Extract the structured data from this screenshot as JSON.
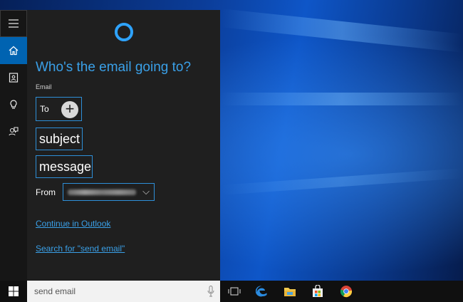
{
  "panel": {
    "heading": "Who's the email going to?",
    "field_label": "Email",
    "to_label": "To",
    "add_symbol": "+",
    "subject_placeholder": "subject",
    "message_placeholder": "message",
    "from_label": "From",
    "from_chevron": "⌵",
    "continue_link": "Continue in Outlook",
    "search_link": "Search for \"send email\""
  },
  "taskbar": {
    "search_value": "send email"
  },
  "colors": {
    "accent": "#3aa0e8",
    "rail_active": "#0063b1",
    "panel_bg": "#1f1f1f"
  },
  "icons": {
    "rail": [
      "hamburger-menu-icon",
      "home-icon",
      "notebook-icon",
      "lightbulb-icon",
      "feedback-icon"
    ],
    "taskbar": [
      "windows-start-icon",
      "microphone-icon",
      "task-view-icon",
      "edge-icon",
      "file-explorer-icon",
      "store-icon",
      "chrome-icon"
    ]
  }
}
